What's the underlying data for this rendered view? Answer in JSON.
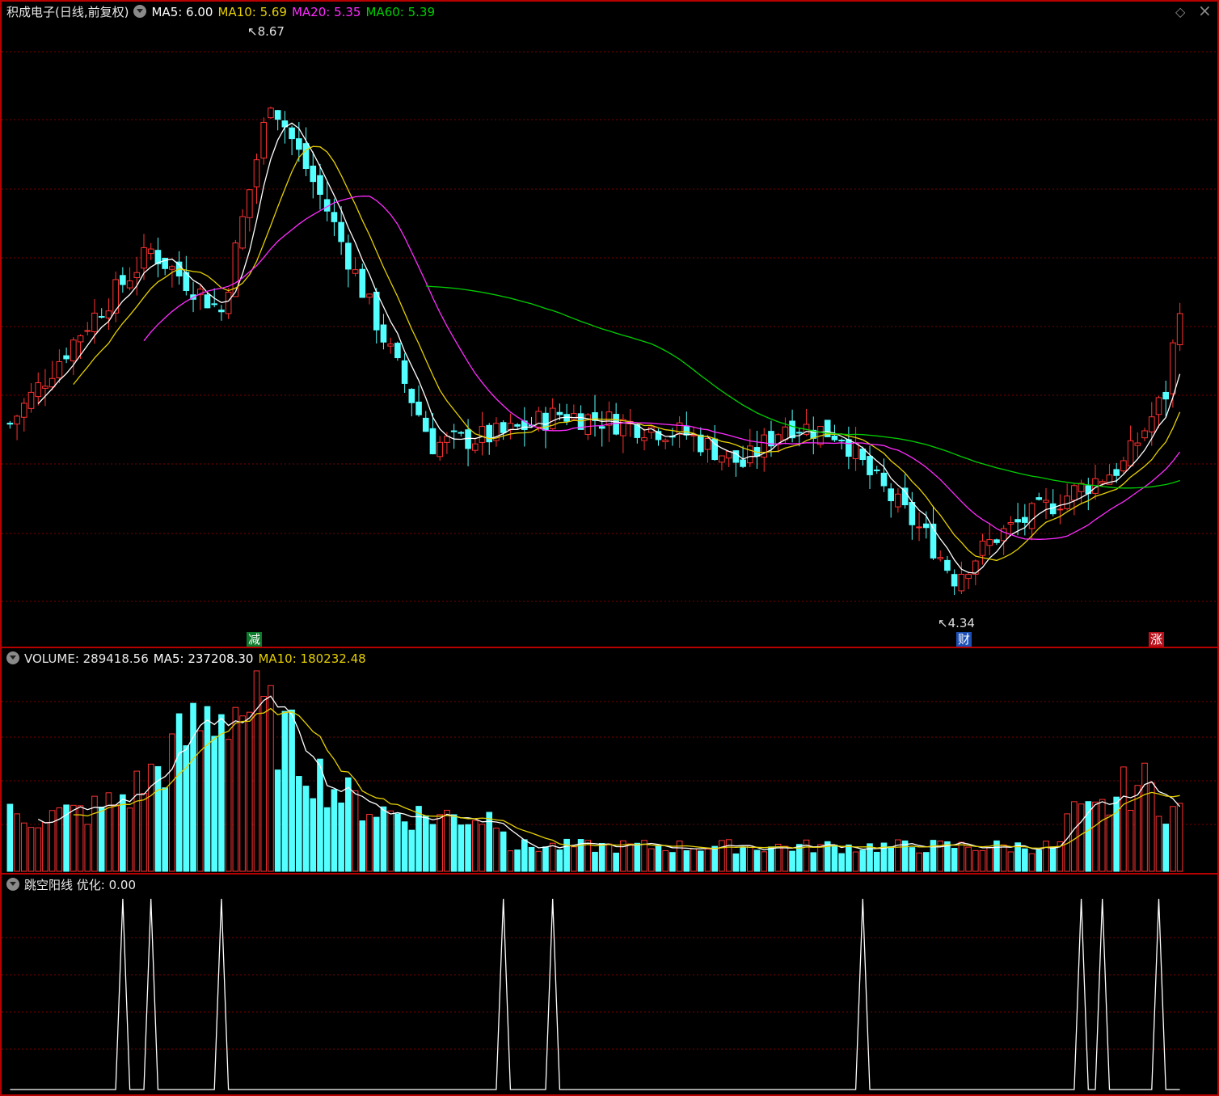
{
  "main": {
    "title": "积成电子(日线,前复权)",
    "ma_labels": [
      {
        "text": "MA5: 6.00",
        "color": "#ffffff"
      },
      {
        "text": "MA10: 5.69",
        "color": "#e6d000"
      },
      {
        "text": "MA20: 5.35",
        "color": "#ff2bff"
      },
      {
        "text": "MA60: 5.39",
        "color": "#00d000"
      }
    ],
    "high_label": "8.67",
    "low_label": "4.34",
    "markers": [
      {
        "text": "减",
        "bg": "#0b7a2a"
      },
      {
        "text": "财",
        "bg": "#1c4fb5"
      },
      {
        "text": "涨",
        "bg": "#b8101a"
      }
    ],
    "price_scale": {
      "min": 4.34,
      "max": 8.67
    }
  },
  "volume": {
    "label": "VOLUME: 289418.56",
    "ma5": "MA5: 237208.30",
    "ma10": "MA10: 180232.48"
  },
  "indicator": {
    "label": "跳空阳线 优化: 0.00",
    "signal_days": [
      16,
      20,
      30,
      70,
      77,
      121,
      152,
      155,
      163
    ]
  },
  "controls": {
    "restore_icon": "◇",
    "close_icon": "×"
  },
  "colors": {
    "up": "#ff3232",
    "down": "#54ffff",
    "grid": "#7a0000",
    "frame": "#b80000"
  }
}
